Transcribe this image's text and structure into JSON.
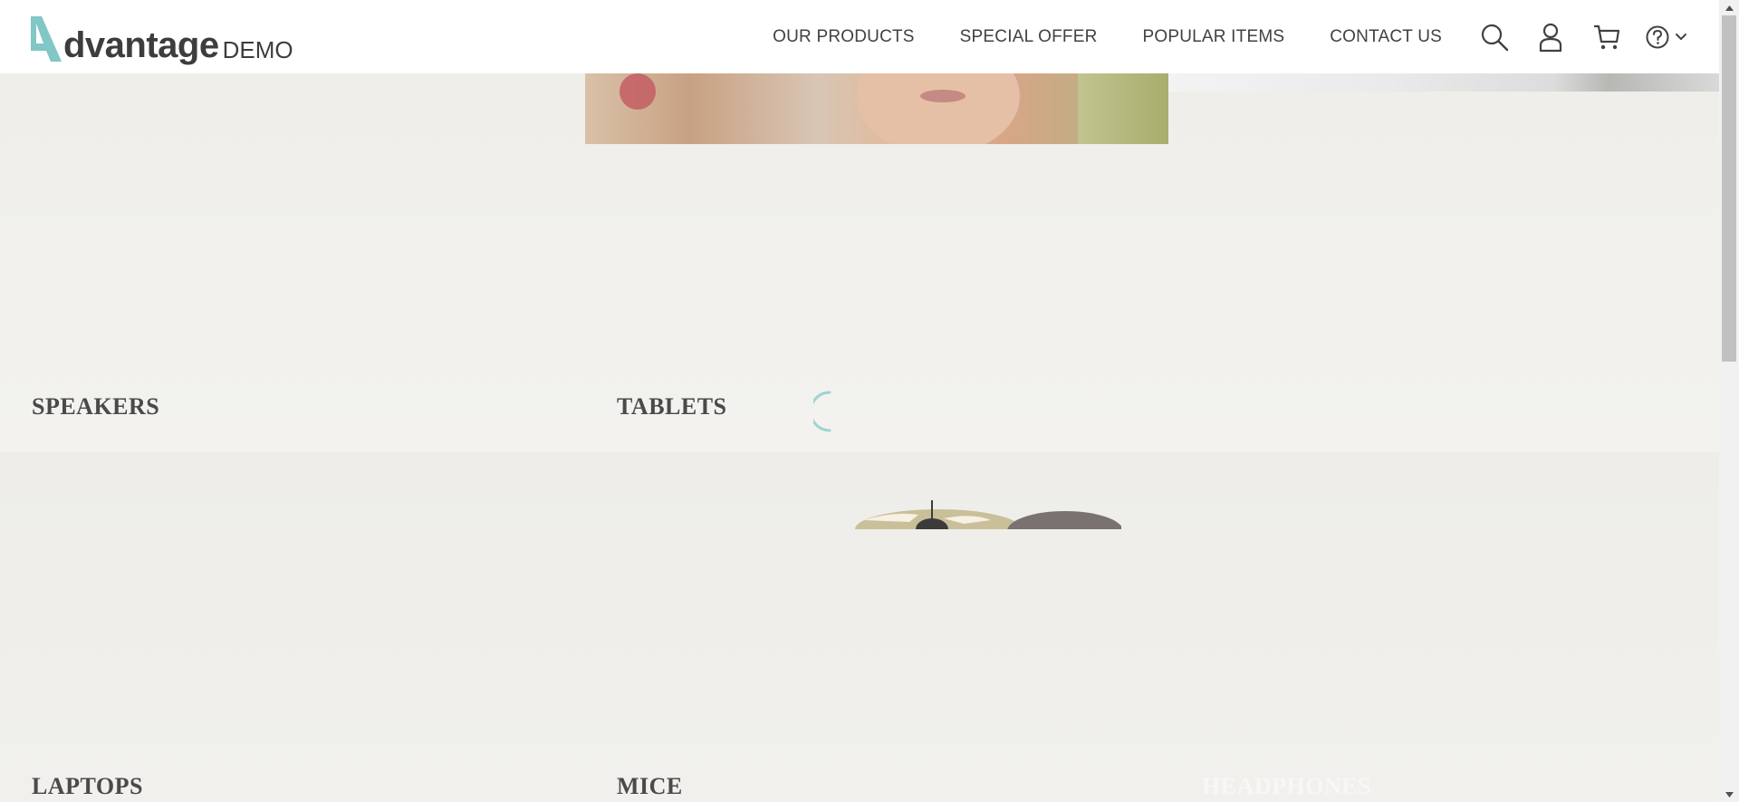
{
  "brand": {
    "name": "dvantage",
    "suffix": "DEMO"
  },
  "nav": {
    "items": [
      {
        "label": "OUR PRODUCTS"
      },
      {
        "label": "SPECIAL OFFER"
      },
      {
        "label": "POPULAR ITEMS"
      },
      {
        "label": "CONTACT US"
      }
    ],
    "icons": [
      "search-icon",
      "user-icon",
      "cart-icon",
      "help-icon",
      "chevron-down-icon"
    ]
  },
  "categories": {
    "speakers": "SPEAKERS",
    "tablets": "TABLETS",
    "laptops": "LAPTOPS",
    "mice": "MICE",
    "headphones": "HEADPHONES"
  },
  "colors": {
    "accent": "#80c7c5",
    "text": "#414141",
    "background": "#f0efec"
  }
}
